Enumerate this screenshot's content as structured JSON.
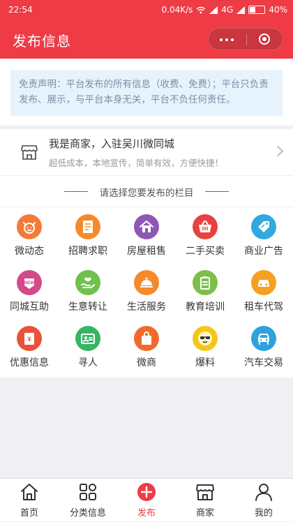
{
  "status_bar": {
    "time": "22:54",
    "speed": "0.04K/s",
    "network": "4G",
    "battery": "40%",
    "battery_level": 0.4
  },
  "header": {
    "title": "发布信息"
  },
  "notice": {
    "text": "免责声明：平台发布的所有信息（收费、免费）；平台只负责发布、展示，与平台本身无关，平台不负任何责任。"
  },
  "merchant": {
    "title": "我是商家，入驻吴川微同城",
    "subtitle": "超低成本，本地宣传，简单有效，方便快捷！"
  },
  "section": {
    "title": "请选择您要发布的栏目"
  },
  "categories": [
    {
      "label": "微动态",
      "icon": "cat-face-icon",
      "color": "#f27b3a"
    },
    {
      "label": "招聘求职",
      "icon": "resume-icon",
      "color": "#f58a2a"
    },
    {
      "label": "房屋租售",
      "icon": "house-icon",
      "color": "#8e57b5"
    },
    {
      "label": "二手买卖",
      "icon": "basket-icon",
      "color": "#e9413f"
    },
    {
      "label": "商业广告",
      "icon": "price-tag-icon",
      "color": "#2fa9df"
    },
    {
      "label": "同城互助",
      "icon": "new-badge-icon",
      "color": "#d24a8a"
    },
    {
      "label": "生意转让",
      "icon": "hand-heart-icon",
      "color": "#6fc04f"
    },
    {
      "label": "生活服务",
      "icon": "cloche-icon",
      "color": "#f58a2a"
    },
    {
      "label": "教育培训",
      "icon": "clipboard-icon",
      "color": "#7bc04a"
    },
    {
      "label": "租车代驾",
      "icon": "car-icon",
      "color": "#f5a01f"
    },
    {
      "label": "优惠信息",
      "icon": "coupon-icon",
      "color": "#e9523a"
    },
    {
      "label": "寻人",
      "icon": "id-card-icon",
      "color": "#38b563"
    },
    {
      "label": "微商",
      "icon": "shopping-bag-icon",
      "color": "#f26a2b"
    },
    {
      "label": "爆料",
      "icon": "sunglasses-face-icon",
      "color": "#f5c518"
    },
    {
      "label": "汽车交易",
      "icon": "car-front-icon",
      "color": "#2fa2de"
    }
  ],
  "tabbar": [
    {
      "label": "首页",
      "icon": "home-icon"
    },
    {
      "label": "分类信息",
      "icon": "grid-icon"
    },
    {
      "label": "发布",
      "icon": "plus-icon",
      "active": true,
      "color": "#ee3b46"
    },
    {
      "label": "商家",
      "icon": "store-icon"
    },
    {
      "label": "我的",
      "icon": "user-icon"
    }
  ]
}
